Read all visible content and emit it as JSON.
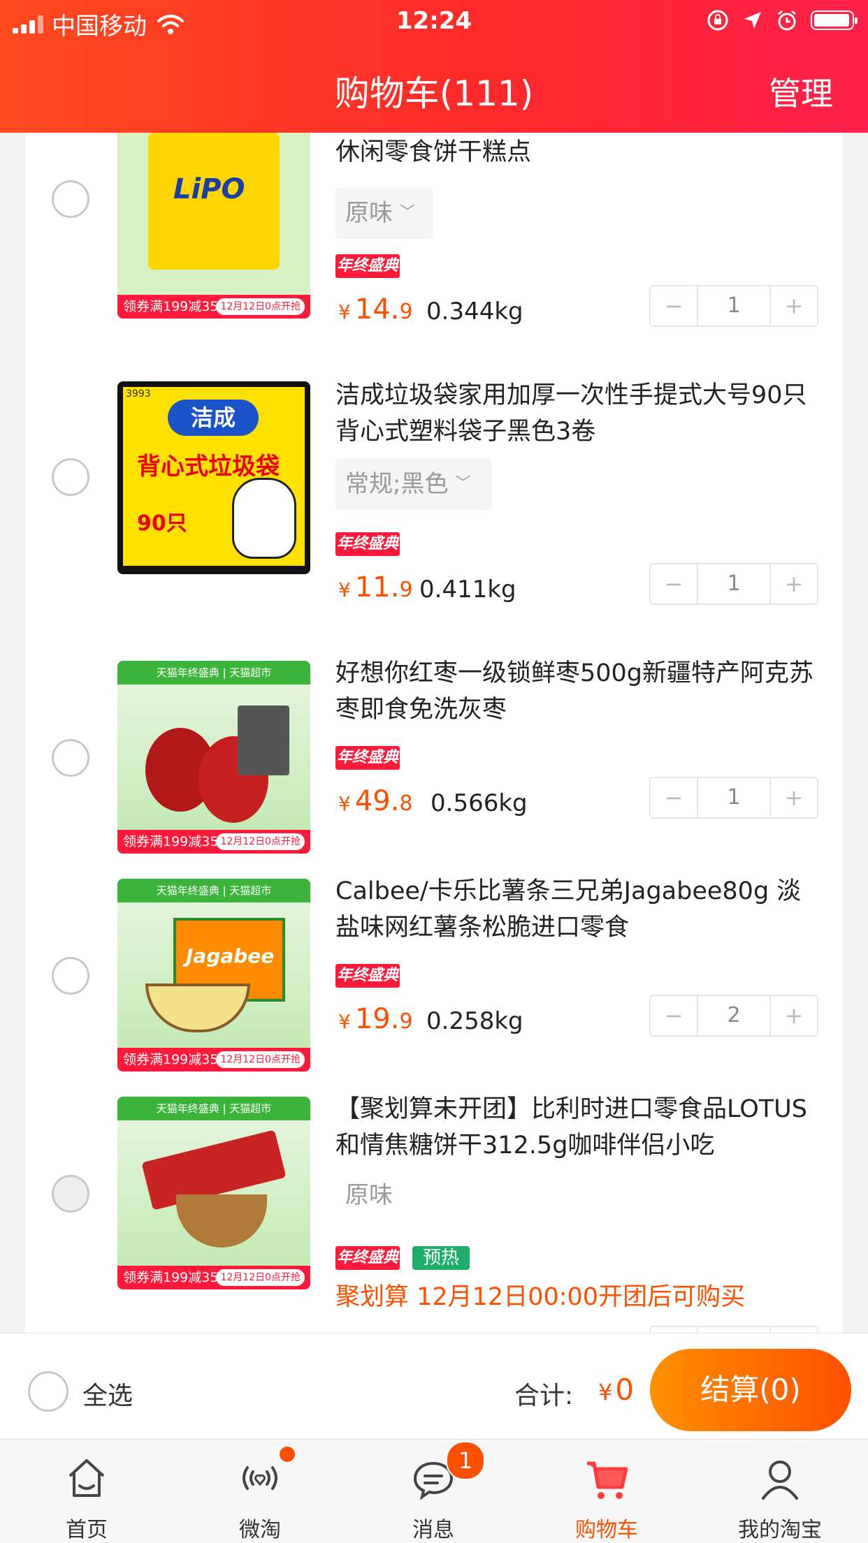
{
  "statusbar": {
    "carrier": "中国移动",
    "time": "12:24"
  },
  "header": {
    "title": "购物车(111)",
    "manage": "管理"
  },
  "items": [
    {
      "name": "休闲零食饼干糕点",
      "variant": "原味",
      "promo_badge": "年终盛典",
      "price_int": "14.",
      "price_dec": "9",
      "weight": "0.344kg",
      "qty": "1",
      "thumb_brand": "LiPO",
      "thumb_coupon": "领券满199减35",
      "thumb_date": "12月12日0点开抢"
    },
    {
      "name": "洁成垃圾袋家用加厚一次性手提式大号90只背心式塑料袋子黑色3卷",
      "variant": "常规;黑色",
      "promo_badge": "年终盛典",
      "price_int": "11.",
      "price_dec": "9",
      "weight": "0.411kg",
      "qty": "1",
      "thumb_brand": "洁成",
      "thumb_text": "背心式垃圾袋",
      "thumb_count": "90只",
      "thumb_code": "3993"
    },
    {
      "name": "好想你红枣一级锁鲜枣500g新疆特产阿克苏枣即食免洗灰枣",
      "promo_badge": "年终盛典",
      "price_int": "49.",
      "price_dec": "8",
      "weight": "0.566kg",
      "qty": "1",
      "thumb_top": "天猫年终盛典 | 天猫超市",
      "thumb_coupon": "领券满199减35",
      "thumb_date": "12月12日0点开抢"
    },
    {
      "name": "Calbee/卡乐比薯条三兄弟Jagabee80g 淡盐味网红薯条松脆进口零食",
      "promo_badge": "年终盛典",
      "price_int": "19.",
      "price_dec": "9",
      "weight": "0.258kg",
      "qty": "2",
      "thumb_top": "天猫年终盛典 | 天猫超市",
      "thumb_brand": "Jagabee",
      "thumb_coupon": "领券满199减35",
      "thumb_date": "12月12日0点开抢"
    },
    {
      "name": "【聚划算未开团】比利时进口零食品LOTUS和情焦糖饼干312.5g咖啡伴侣小吃",
      "variant": "原味",
      "promo_badge": "年终盛典",
      "preheat_badge": "预热",
      "juhuasuan_note": "聚划算 12月12日00:00开团后可购买",
      "thumb_top": "天猫年终盛典 | 天猫超市",
      "thumb_coupon": "领券满199减35",
      "thumb_date": "12月12日0点开抢"
    }
  ],
  "bottombar": {
    "select_all": "全选",
    "total_label": "合计:",
    "total_yen": "¥",
    "total_value": "0",
    "checkout": "结算(0)"
  },
  "tabs": [
    {
      "label": "首页",
      "icon": "home-icon"
    },
    {
      "label": "微淘",
      "icon": "weitao-icon"
    },
    {
      "label": "消息",
      "icon": "message-icon",
      "badge": "1"
    },
    {
      "label": "购物车",
      "icon": "cart-icon"
    },
    {
      "label": "我的淘宝",
      "icon": "profile-icon"
    }
  ],
  "colors": {
    "accent": "#ff5000",
    "header_start": "#ff4a1f",
    "header_end": "#ff1f4a",
    "promo_red": "#ff1a3b",
    "preheat_green": "#1fae6a"
  }
}
